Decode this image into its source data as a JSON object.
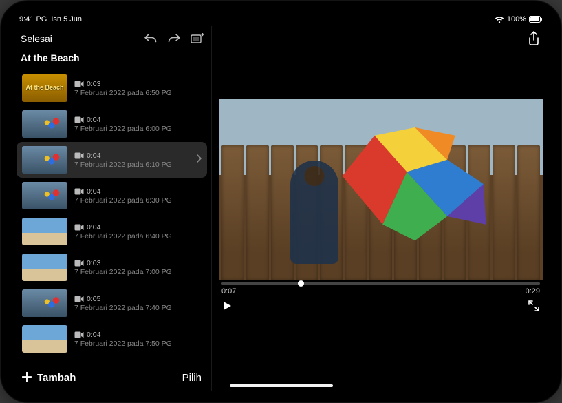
{
  "status_bar": {
    "time": "9:41 PG",
    "date": "Isn 5 Jun",
    "battery_pct": "100%"
  },
  "left": {
    "done_label": "Selesai",
    "project_title": "At the Beach",
    "add_label": "Tambah",
    "select_label": "Pilih"
  },
  "clips": [
    {
      "title_card": true,
      "title_text": "At the Beach",
      "duration": "0:03",
      "timestamp": "7 Februari 2022 pada 6:50 PG",
      "thumb_class": "title-card"
    },
    {
      "title_card": false,
      "duration": "0:04",
      "timestamp": "7 Februari 2022 pada 6:00 PG",
      "thumb_class": "kite"
    },
    {
      "title_card": false,
      "duration": "0:04",
      "timestamp": "7 Februari 2022 pada 6:10 PG",
      "thumb_class": "kite",
      "selected": true
    },
    {
      "title_card": false,
      "duration": "0:04",
      "timestamp": "7 Februari 2022 pada 6:30 PG",
      "thumb_class": "kite"
    },
    {
      "title_card": false,
      "duration": "0:04",
      "timestamp": "7 Februari 2022 pada 6:40 PG",
      "thumb_class": "beach"
    },
    {
      "title_card": false,
      "duration": "0:03",
      "timestamp": "7 Februari 2022 pada 7:00 PG",
      "thumb_class": "beach"
    },
    {
      "title_card": false,
      "duration": "0:05",
      "timestamp": "7 Februari 2022 pada 7:40 PG",
      "thumb_class": "kite"
    },
    {
      "title_card": false,
      "duration": "0:04",
      "timestamp": "7 Februari 2022 pada 7:50 PG",
      "thumb_class": "beach"
    }
  ],
  "viewer": {
    "current_time": "0:07",
    "total_time": "0:29"
  },
  "icons": {
    "undo": "undo-icon",
    "redo": "redo-icon",
    "storyboard": "storyboard-icon",
    "share": "share-icon",
    "wifi": "wifi-icon",
    "battery": "battery-icon",
    "video": "video-camera-icon",
    "chevron": "chevron-right-icon",
    "play": "play-icon",
    "expand": "expand-icon",
    "plus": "plus-icon"
  },
  "colors": {
    "kite_red": "#d93a2b",
    "kite_orange": "#f08a24",
    "kite_yellow": "#f4d13a",
    "kite_green": "#3fae4f",
    "kite_blue": "#2f7dd1",
    "kite_purple": "#5e3fa8"
  }
}
